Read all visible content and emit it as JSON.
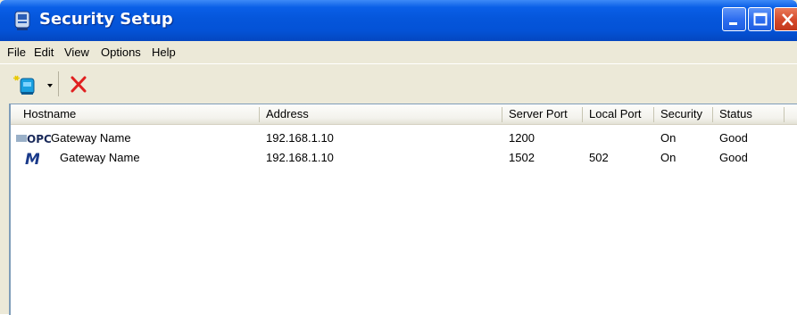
{
  "window": {
    "title": "Security Setup",
    "app_icon": "gateway-icon",
    "controls": [
      "minimize",
      "maximize",
      "close"
    ]
  },
  "menu": {
    "items": [
      "File",
      "Edit",
      "View",
      "Options",
      "Help"
    ]
  },
  "toolbar": {
    "new_icon": "new-gateway-icon",
    "dropdown_icon": "dropdown-arrow-icon",
    "delete_icon": "delete-x-icon"
  },
  "list": {
    "columns": [
      "Hostname",
      "Address",
      "Server Port",
      "Local Port",
      "Security",
      "Status"
    ],
    "rows": [
      {
        "icon": "opc-icon",
        "icon_text": "OPC",
        "hostname": "Gateway Name",
        "address": "192.168.1.10",
        "server_port": "1200",
        "local_port": "",
        "security": "On",
        "status": "Good"
      },
      {
        "icon": "modbus-m-icon",
        "icon_text": "M",
        "hostname": "Gateway Name",
        "address": "192.168.1.10",
        "server_port": "1502",
        "local_port": "502",
        "security": "On",
        "status": "Good"
      }
    ]
  },
  "colors": {
    "titlebar": "#0556db",
    "chrome": "#ece9d8",
    "close_button": "#d4482a",
    "delete_red": "#e02020"
  }
}
